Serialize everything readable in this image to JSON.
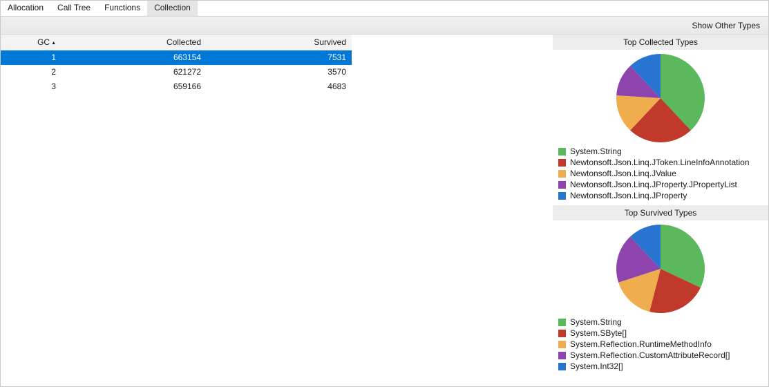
{
  "tabs": {
    "items": [
      "Allocation",
      "Call Tree",
      "Functions",
      "Collection"
    ],
    "active_index": 3
  },
  "topbar": {
    "show_other_types": "Show Other Types"
  },
  "table": {
    "headers": {
      "gc": "GC",
      "collected": "Collected",
      "survived": "Survived"
    },
    "sort_indicator": "▲",
    "rows": [
      {
        "gc": "1",
        "collected": "663154",
        "survived": "7531",
        "selected": true
      },
      {
        "gc": "2",
        "collected": "621272",
        "survived": "3570",
        "selected": false
      },
      {
        "gc": "3",
        "collected": "659166",
        "survived": "4683",
        "selected": false
      }
    ]
  },
  "colors": {
    "green": "#5cb85c",
    "red": "#c0392b",
    "yellow": "#f0ad4e",
    "purple": "#8e44ad",
    "blue": "#2874d1"
  },
  "charts": {
    "collected": {
      "title": "Top Collected Types",
      "items": [
        {
          "label": "System.String",
          "color": "green",
          "value": 38
        },
        {
          "label": "Newtonsoft.Json.Linq.JToken.LineInfoAnnotation",
          "color": "red",
          "value": 24
        },
        {
          "label": "Newtonsoft.Json.Linq.JValue",
          "color": "yellow",
          "value": 14
        },
        {
          "label": "Newtonsoft.Json.Linq.JProperty.JPropertyList",
          "color": "purple",
          "value": 12
        },
        {
          "label": "Newtonsoft.Json.Linq.JProperty",
          "color": "blue",
          "value": 12
        }
      ]
    },
    "survived": {
      "title": "Top Survived Types",
      "items": [
        {
          "label": "System.String",
          "color": "green",
          "value": 32
        },
        {
          "label": "System.SByte[]",
          "color": "red",
          "value": 22
        },
        {
          "label": "System.Reflection.RuntimeMethodInfo",
          "color": "yellow",
          "value": 16
        },
        {
          "label": "System.Reflection.CustomAttributeRecord[]",
          "color": "purple",
          "value": 18
        },
        {
          "label": "System.Int32[]",
          "color": "blue",
          "value": 12
        }
      ]
    }
  },
  "chart_data": [
    {
      "type": "pie",
      "title": "Top Collected Types",
      "series": [
        {
          "name": "System.String",
          "value": 38
        },
        {
          "name": "Newtonsoft.Json.Linq.JToken.LineInfoAnnotation",
          "value": 24
        },
        {
          "name": "Newtonsoft.Json.Linq.JValue",
          "value": 14
        },
        {
          "name": "Newtonsoft.Json.Linq.JProperty.JPropertyList",
          "value": 12
        },
        {
          "name": "Newtonsoft.Json.Linq.JProperty",
          "value": 12
        }
      ]
    },
    {
      "type": "pie",
      "title": "Top Survived Types",
      "series": [
        {
          "name": "System.String",
          "value": 32
        },
        {
          "name": "System.SByte[]",
          "value": 22
        },
        {
          "name": "System.Reflection.RuntimeMethodInfo",
          "value": 16
        },
        {
          "name": "System.Reflection.CustomAttributeRecord[]",
          "value": 18
        },
        {
          "name": "System.Int32[]",
          "value": 12
        }
      ]
    },
    {
      "type": "table",
      "title": "GC Collection",
      "columns": [
        "GC",
        "Collected",
        "Survived"
      ],
      "rows": [
        [
          1,
          663154,
          7531
        ],
        [
          2,
          621272,
          3570
        ],
        [
          3,
          659166,
          4683
        ]
      ]
    }
  ]
}
